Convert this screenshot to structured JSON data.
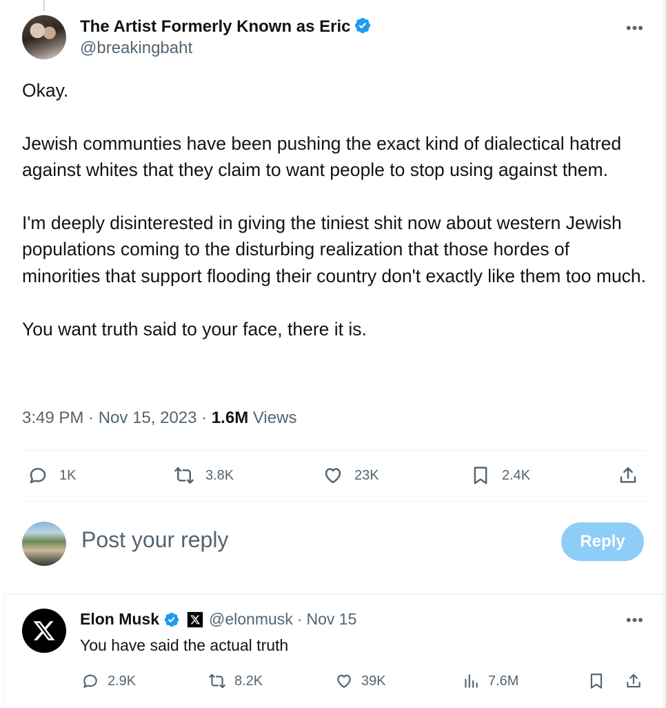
{
  "tweet": {
    "display_name": "The Artist Formerly Known as Eric",
    "handle": "@breakingbaht",
    "paragraphs": [
      "Okay.",
      "Jewish communties have been pushing the exact kind of dialectical hatred against whites that they claim to want people to stop using against them.",
      "I'm deeply disinterested in giving the tiniest shit now about western Jewish populations coming to the disturbing realization that those hordes of minorities that support flooding their country don't exactly like them too much.",
      "You want truth said to your face, there it is."
    ],
    "time": "3:49 PM",
    "date": "Nov 15, 2023",
    "views_count": "1.6M",
    "views_label": "Views",
    "replies": "1K",
    "reposts": "3.8K",
    "likes": "23K",
    "bookmarks": "2.4K"
  },
  "composer": {
    "placeholder": "Post your reply",
    "button_label": "Reply"
  },
  "reply": {
    "display_name": "Elon Musk",
    "handle": "@elonmusk",
    "date": "Nov 15",
    "text": "You have said the actual truth",
    "replies": "2.9K",
    "reposts": "8.2K",
    "likes": "39K",
    "views": "7.6M"
  },
  "colors": {
    "accent": "#1d9bf0",
    "reply_button": "#8ecdf8",
    "secondary_text": "#536471"
  },
  "icons": [
    "verified-badge-icon",
    "more-icon",
    "reply-icon",
    "repost-icon",
    "like-icon",
    "bookmark-icon",
    "share-icon",
    "views-icon",
    "x-logo-icon"
  ]
}
